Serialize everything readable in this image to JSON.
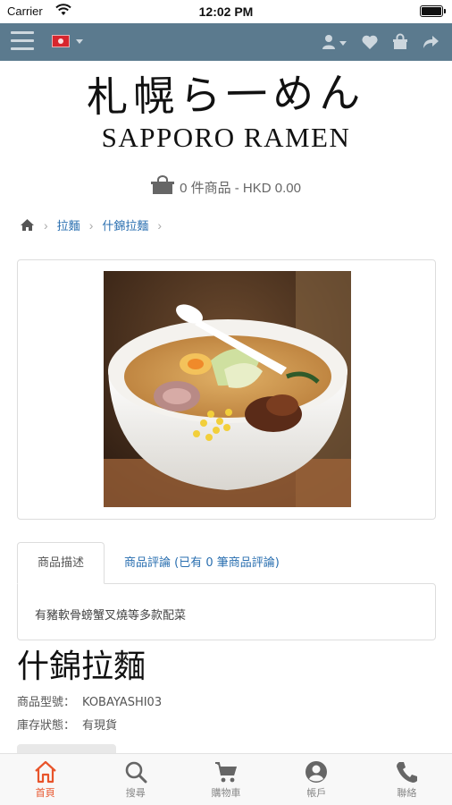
{
  "status_bar": {
    "carrier": "Carrier",
    "time": "12:02 PM"
  },
  "nav": {
    "icons": [
      "menu-icon",
      "hk-flag-icon",
      "user-icon",
      "heart-icon",
      "shopping-bag-icon",
      "share-icon"
    ],
    "bar_color": "#5b7a8e"
  },
  "logo": {
    "japanese": "札幌ら一めん",
    "english": "SAPPORO RAMEN"
  },
  "cart": {
    "summary": "0 件商品 - HKD 0.00"
  },
  "breadcrumb": {
    "items": [
      "拉麵",
      "什錦拉麵"
    ]
  },
  "tabs": {
    "active_label": "商品描述",
    "reviews_label": "商品評論 (已有 0 筆商品評論)",
    "description": "有豬軟骨螃蟹叉燒等多款配菜"
  },
  "product": {
    "title": "什錦拉麵",
    "model_label": "商品型號：",
    "model_value": "KOBAYASHI03",
    "stock_label": "庫存狀態：",
    "stock_value": "有現貨"
  },
  "tabbar": {
    "items": [
      {
        "label": "首頁",
        "icon": "home-icon"
      },
      {
        "label": "搜尋",
        "icon": "search-icon"
      },
      {
        "label": "購物車",
        "icon": "cart-icon"
      },
      {
        "label": "帳戶",
        "icon": "account-icon"
      },
      {
        "label": "聯絡",
        "icon": "phone-icon"
      }
    ],
    "active_color": "#e8542b"
  }
}
